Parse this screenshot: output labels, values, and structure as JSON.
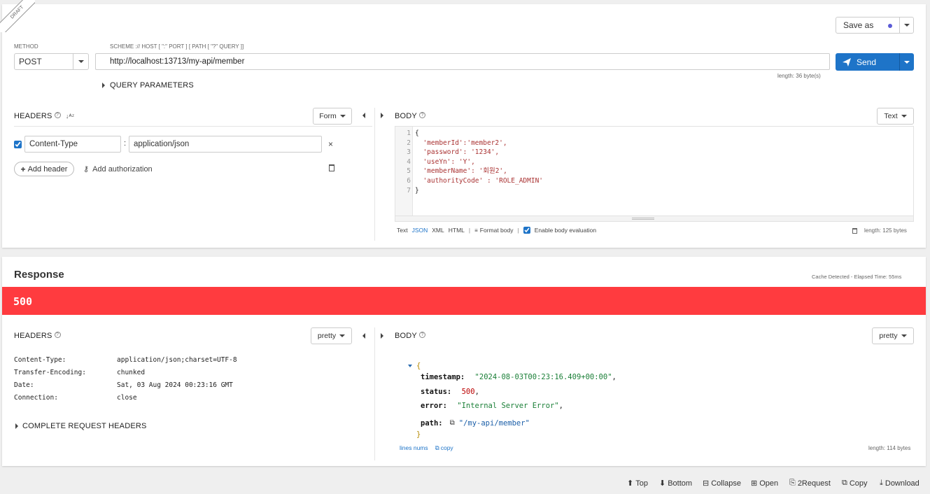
{
  "draft_label": "DRAFT",
  "request": {
    "method_label": "METHOD",
    "method_value": "POST",
    "url_label": "SCHEME :// HOST [ \":\" PORT ] [ PATH [ \"?\" QUERY ]]",
    "url_value": "http://localhost:13713/my-api/member",
    "url_length": "length: 36 byte(s)",
    "save_as": "Save as",
    "send": "Send",
    "query_parameters": "QUERY PARAMETERS",
    "headers_title": "HEADERS",
    "headers_mode": "Form",
    "headers": [
      {
        "name": "Content-Type",
        "value": "application/json",
        "enabled": true
      }
    ],
    "add_header": "Add header",
    "add_authorization": "Add authorization",
    "body_title": "BODY",
    "body_mode": "Text",
    "body_lines": [
      {
        "num": "1",
        "text": "{"
      },
      {
        "num": "2",
        "text": "  'memberId':'member2',"
      },
      {
        "num": "3",
        "text": "  'password': '1234',"
      },
      {
        "num": "4",
        "text": "  'useYn': 'Y',"
      },
      {
        "num": "5",
        "text": "  'memberName': '회원2',"
      },
      {
        "num": "6",
        "text": "  'authorityCode' : 'ROLE_ADMIN'"
      },
      {
        "num": "7",
        "text": "}"
      }
    ],
    "body_formats": [
      "Text",
      "JSON",
      "XML",
      "HTML"
    ],
    "body_format_active": "JSON",
    "format_body": "Format body",
    "enable_body_evaluation": "Enable body evaluation",
    "body_length": "length: 125 bytes"
  },
  "response": {
    "title": "Response",
    "cache_info": "Cache Detected - Elapsed Time: 55ms",
    "status_code": "500",
    "status_color": "#ff3b3f",
    "headers_title": "HEADERS",
    "headers_mode": "pretty",
    "headers": [
      {
        "name": "Content-Type:",
        "value": "application/json;charset=UTF-8"
      },
      {
        "name": "Transfer-Encoding:",
        "value": "chunked"
      },
      {
        "name": "Date:",
        "value": "Sat, 03 Aug 2024 00:23:16 GMT"
      },
      {
        "name": "Connection:",
        "value": "close"
      }
    ],
    "complete_request_headers": "COMPLETE REQUEST HEADERS",
    "body_title": "BODY",
    "body_mode": "pretty",
    "json": {
      "open_brace": "{",
      "close_brace": "}",
      "timestamp_key": "timestamp:",
      "timestamp_val": "\"2024-08-03T00:23:16.409+00:00\"",
      "status_key": "status:",
      "status_val": "500",
      "error_key": "error:",
      "error_val": "\"Internal Server Error\"",
      "path_key": "path:",
      "path_val": "\"/my-api/member\""
    },
    "lines_nums": "lines nums",
    "copy": "copy",
    "body_length": "length: 114 bytes"
  },
  "footer": {
    "top": "Top",
    "bottom": "Bottom",
    "collapse": "Collapse",
    "open": "Open",
    "to_request": "2Request",
    "copy": "Copy",
    "download": "Download"
  },
  "colors": {
    "accent": "#1e74c8",
    "error": "#ff3b3f",
    "dot": "#5b5bd6"
  }
}
